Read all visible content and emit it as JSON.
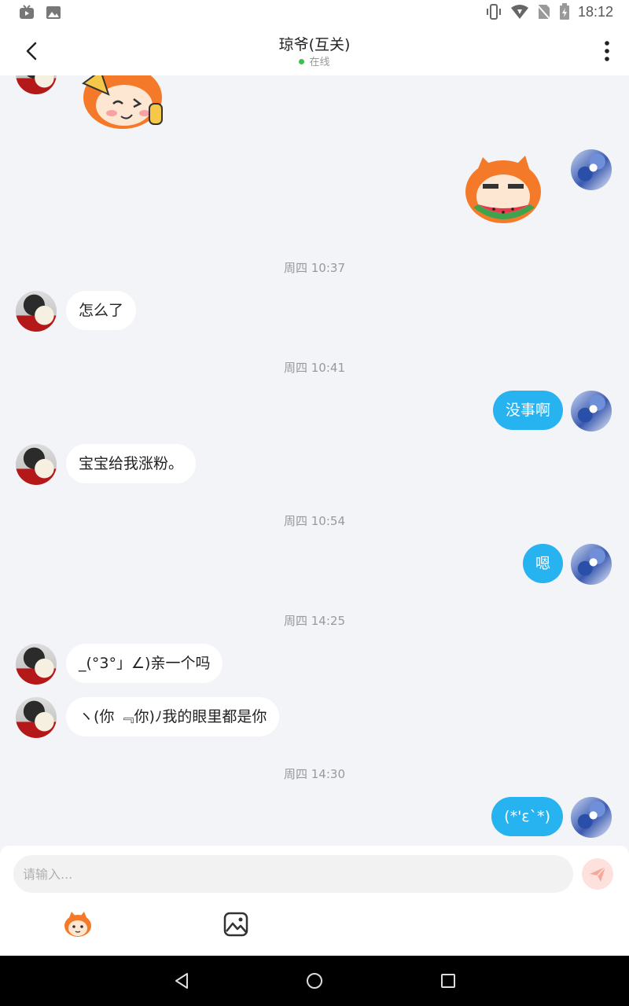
{
  "status_bar": {
    "time": "18:12"
  },
  "header": {
    "title": "琼爷(互关)",
    "status": "在线"
  },
  "messages": [
    {
      "timestamp": "周四 10:37"
    },
    {
      "text": "怎么了"
    },
    {
      "timestamp": "周四 10:41"
    },
    {
      "text": "没事啊"
    },
    {
      "text": "宝宝给我涨粉。"
    },
    {
      "timestamp": "周四 10:54"
    },
    {
      "text": "嗯"
    },
    {
      "timestamp": "周四 14:25"
    },
    {
      "text": "_(°3°」∠)亲一个吗"
    },
    {
      "text": "ヽ(你 ﹃你)ﾉ我的眼里都是你"
    },
    {
      "timestamp": "周四 14:30"
    },
    {
      "text": "(*'ε`*)"
    }
  ],
  "composer": {
    "placeholder": "请输入..."
  },
  "colors": {
    "accent": "#27b2f0",
    "online": "#3ac24d",
    "send_disabled": "#fde1dc"
  }
}
